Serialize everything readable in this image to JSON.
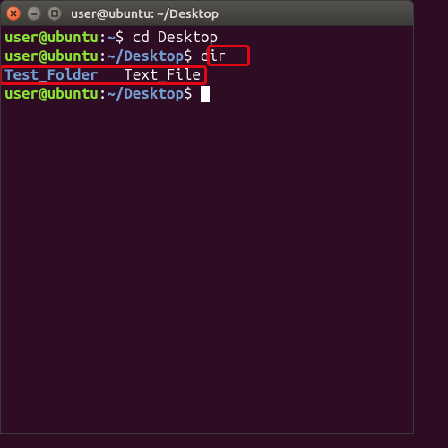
{
  "window": {
    "title": "user@ubuntu: ~/Desktop"
  },
  "terminal": {
    "line1": {
      "user": "user",
      "at": "@",
      "host": "ubuntu",
      "colon": ":",
      "path": "~",
      "dollar": "$ ",
      "cmd": "cd Desktop"
    },
    "line2": {
      "user": "user",
      "at": "@",
      "host": "ubuntu",
      "colon": ":",
      "path": "~/Desktop",
      "dollar": "$ ",
      "cmd": "dir"
    },
    "output": {
      "dir_item": "Test_Folder",
      "gap": "   ",
      "file_item": "Text_File"
    },
    "line4": {
      "user": "user",
      "at": "@",
      "host": "ubuntu",
      "colon": ":",
      "path": "~/Desktop",
      "dollar": "$ "
    }
  }
}
